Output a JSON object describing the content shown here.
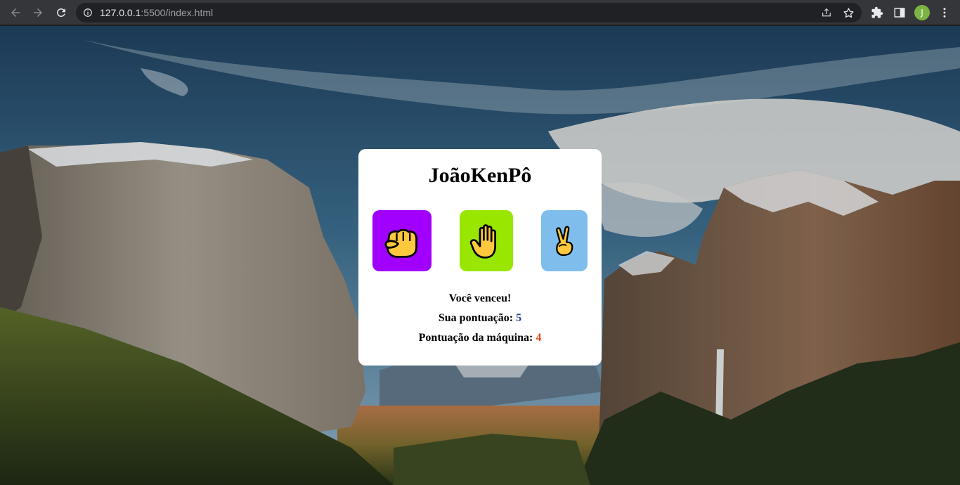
{
  "browser": {
    "url_host": "127.0.0.1",
    "url_rest": ":5500/index.html",
    "profile_initial": "J"
  },
  "game": {
    "title": "JoãoKenPô",
    "choices": [
      {
        "name": "rock",
        "icon": "fist-icon",
        "color": "#a100ff"
      },
      {
        "name": "paper",
        "icon": "raised-hand-icon",
        "color": "#99e600"
      },
      {
        "name": "scissors",
        "icon": "victory-hand-icon",
        "color": "#7fbdec"
      }
    ],
    "result": "Você venceu!",
    "user_score_label": "Sua pontuação:",
    "user_score": "5",
    "machine_score_label": "Pontuação da máquina:",
    "machine_score": "4"
  }
}
